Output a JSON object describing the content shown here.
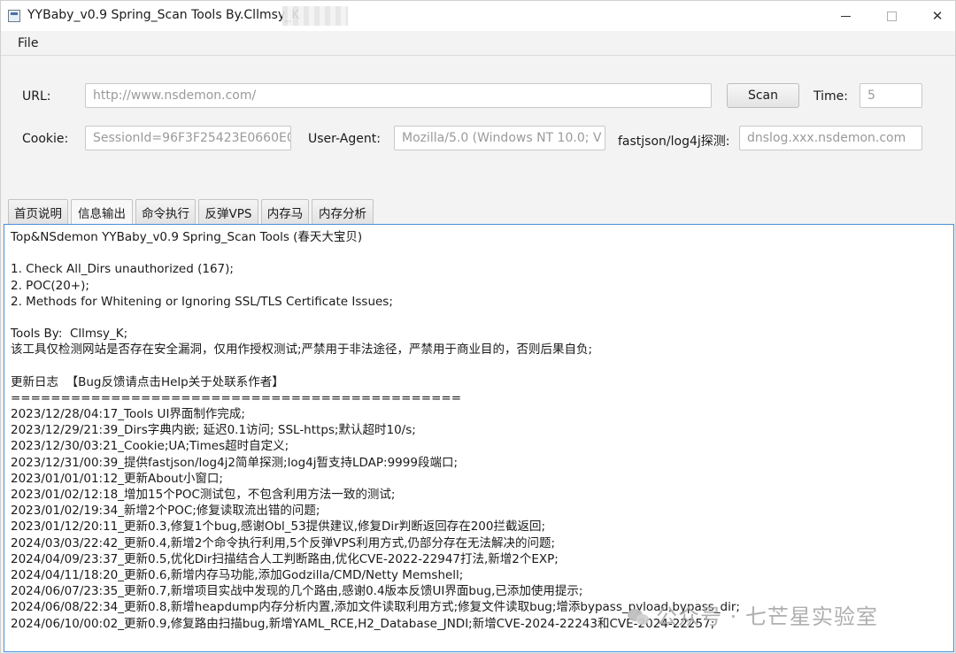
{
  "window": {
    "title": "YYBaby_v0.9 Spring_Scan Tools By.Cllmsy_K",
    "controls": {
      "minimize": "",
      "maximize": "",
      "close": "✕"
    }
  },
  "menu": {
    "file": "File"
  },
  "form": {
    "url_label": "URL:",
    "url_placeholder": "http://www.nsdemon.com/",
    "scan_label": "Scan",
    "time_label": "Time:",
    "time_placeholder": "5",
    "cookie_label": "Cookie:",
    "cookie_placeholder": "SessionId=96F3F25423E0660E0",
    "ua_label": "User-Agent:",
    "ua_placeholder": "Mozilla/5.0 (Windows NT 10.0; V",
    "fastjson_label": "fastjson/log4j探测:",
    "fastjson_placeholder": "dnslog.xxx.nsdemon.com"
  },
  "tabs": [
    "首页说明",
    "信息输出",
    "命令执行",
    "反弹VPS",
    "内存马",
    "内存分析"
  ],
  "content_lines": [
    "Top&NSdemon YYBaby_v0.9 Spring_Scan Tools (春天大宝贝)",
    "",
    "1. Check All_Dirs unauthorized (167);",
    "2. POC(20+);",
    "2. Methods for Whitening or Ignoring SSL/TLS Certificate Issues;",
    "",
    "Tools By:  Cllmsy_K;",
    "该工具仅检测网站是否存在安全漏洞，仅用作授权测试;严禁用于非法途径，严禁用于商业目的，否则后果自负;",
    "",
    "更新日志  【Bug反馈请点击Help关于处联系作者】",
    "=============================================",
    "2023/12/28/04:17_Tools UI界面制作完成;",
    "2023/12/29/21:39_Dirs字典内嵌; 延迟0.1访问; SSL-https;默认超时10/s;",
    "2023/12/30/03:21_Cookie;UA;Times超时自定义;",
    "2023/12/31/00:39_提供fastjson/log4j2简单探测;log4j暂支持LDAP:9999段端口;",
    "2023/01/01/01:12_更新About小窗口;",
    "2023/01/02/12:18_增加15个POC测试包，不包含利用方法一致的测试;",
    "2023/01/02/19:34_新增2个POC;修复读取流出错的问题;",
    "2023/01/12/20:11_更新0.3,修复1个bug,感谢Obl_53提供建议,修复Dir判断返回存在200拦截返回;",
    "2024/03/03/22:42_更新0.4,新增2个命令执行利用,5个反弹VPS利用方式,仍部分存在无法解决的问题;",
    "2024/04/09/23:37_更新0.5,优化Dir扫描结合人工判断路由,优化CVE-2022-22947打法,新增2个EXP;",
    "2024/04/11/18:20_更新0.6,新增内存马功能,添加Godzilla/CMD/Netty Memshell;",
    "2024/06/07/23:35_更新0.7,新增项目实战中发现的几个路由,感谢0.4版本反馈UI界面bug,已添加使用提示;",
    "2024/06/08/22:34_更新0.8,新增heapdump内存分析内置,添加文件读取利用方式;修复文件读取bug;增添bypass_pyload,bypass_dir;",
    "2024/06/10/00:02_更新0.9,修复路由扫描bug,新增YAML_RCE,H2_Database_JNDI;新增CVE-2024-22243和CVE-2024-22257;"
  ],
  "watermark": "公众号 · 七芒星实验室"
}
